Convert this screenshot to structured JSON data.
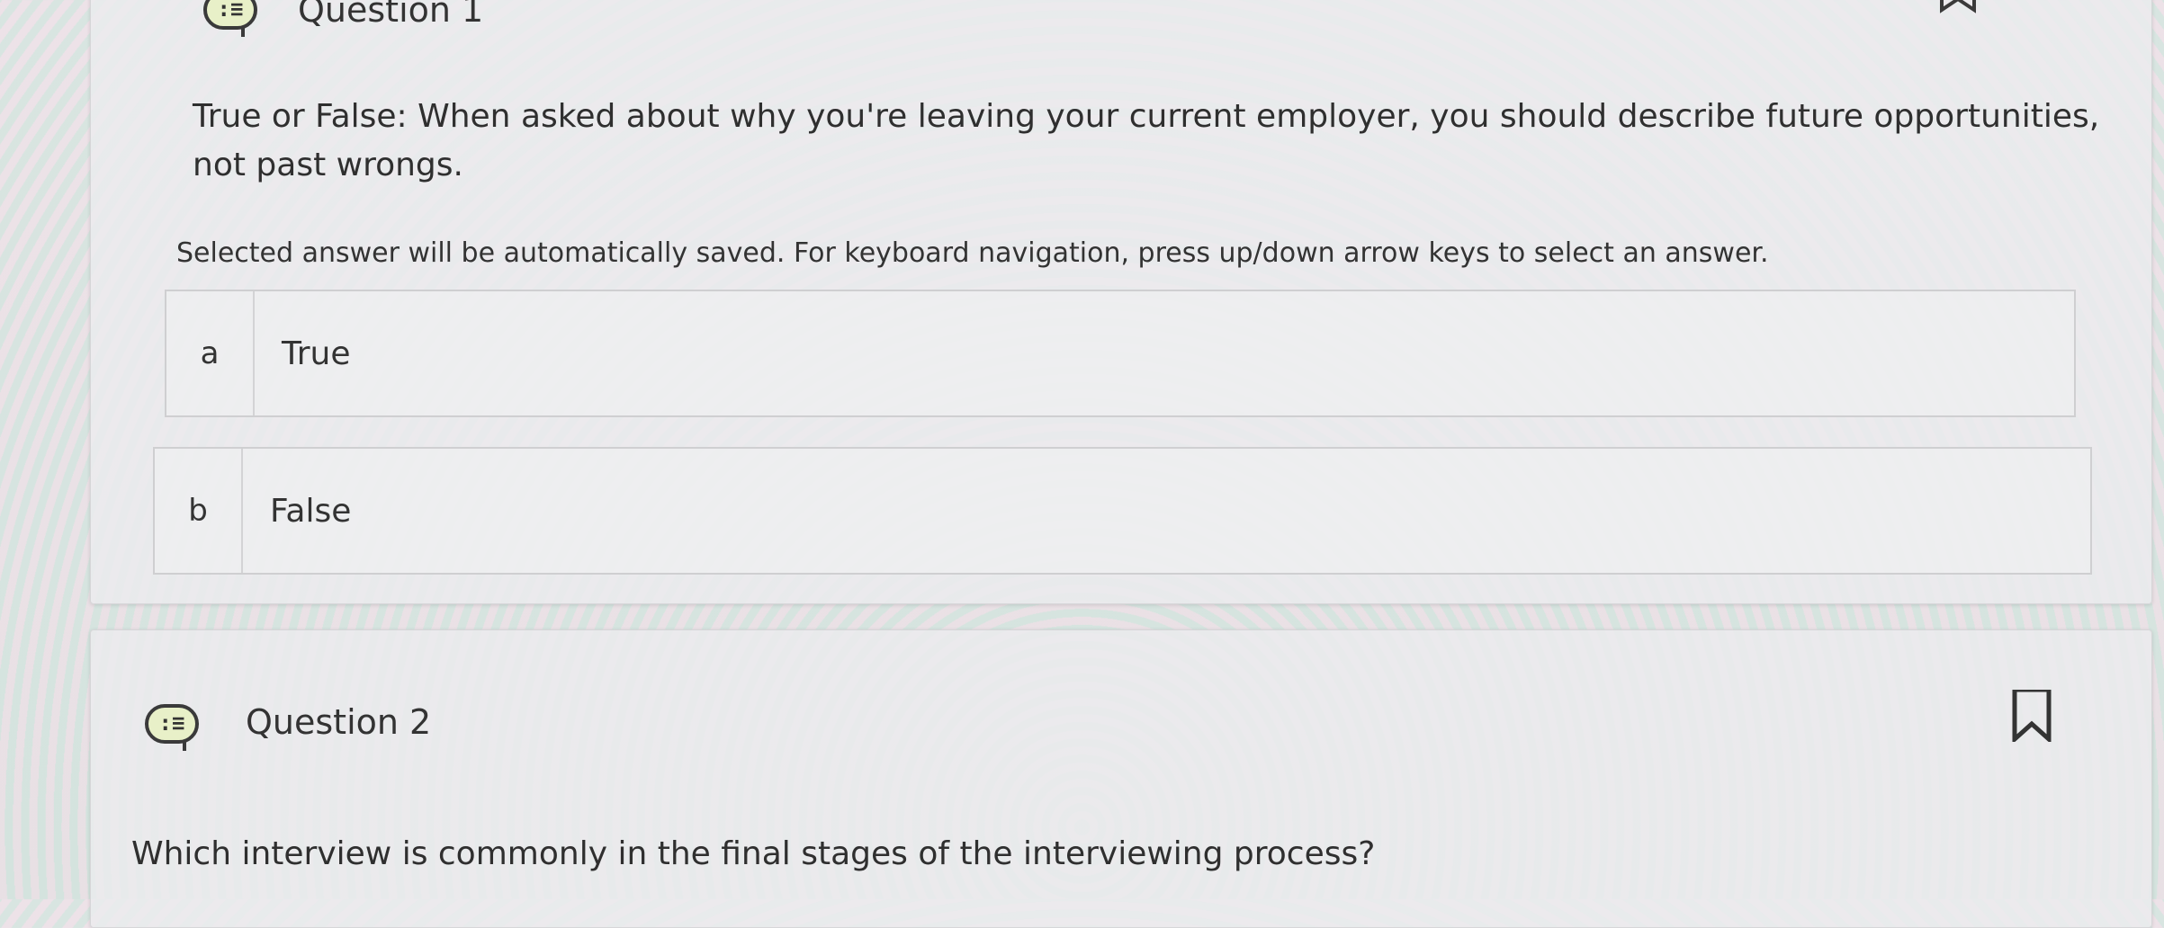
{
  "question1": {
    "icon": "question-list-icon",
    "icon_glyph": ":≡",
    "title": "Question 1",
    "text": "True or False: When asked about why you're leaving your current employer, you should describe future opportunities, not past wrongs.",
    "hint": "Selected answer will be automatically saved. For keyboard navigation, press up/down arrow keys to select an answer.",
    "options": [
      {
        "letter": "a",
        "label": "True"
      },
      {
        "letter": "b",
        "label": "False"
      }
    ]
  },
  "question2": {
    "icon": "question-list-icon",
    "icon_glyph": ":≡",
    "title": "Question 2",
    "text": "Which interview is commonly in the final stages of the interviewing process?"
  }
}
